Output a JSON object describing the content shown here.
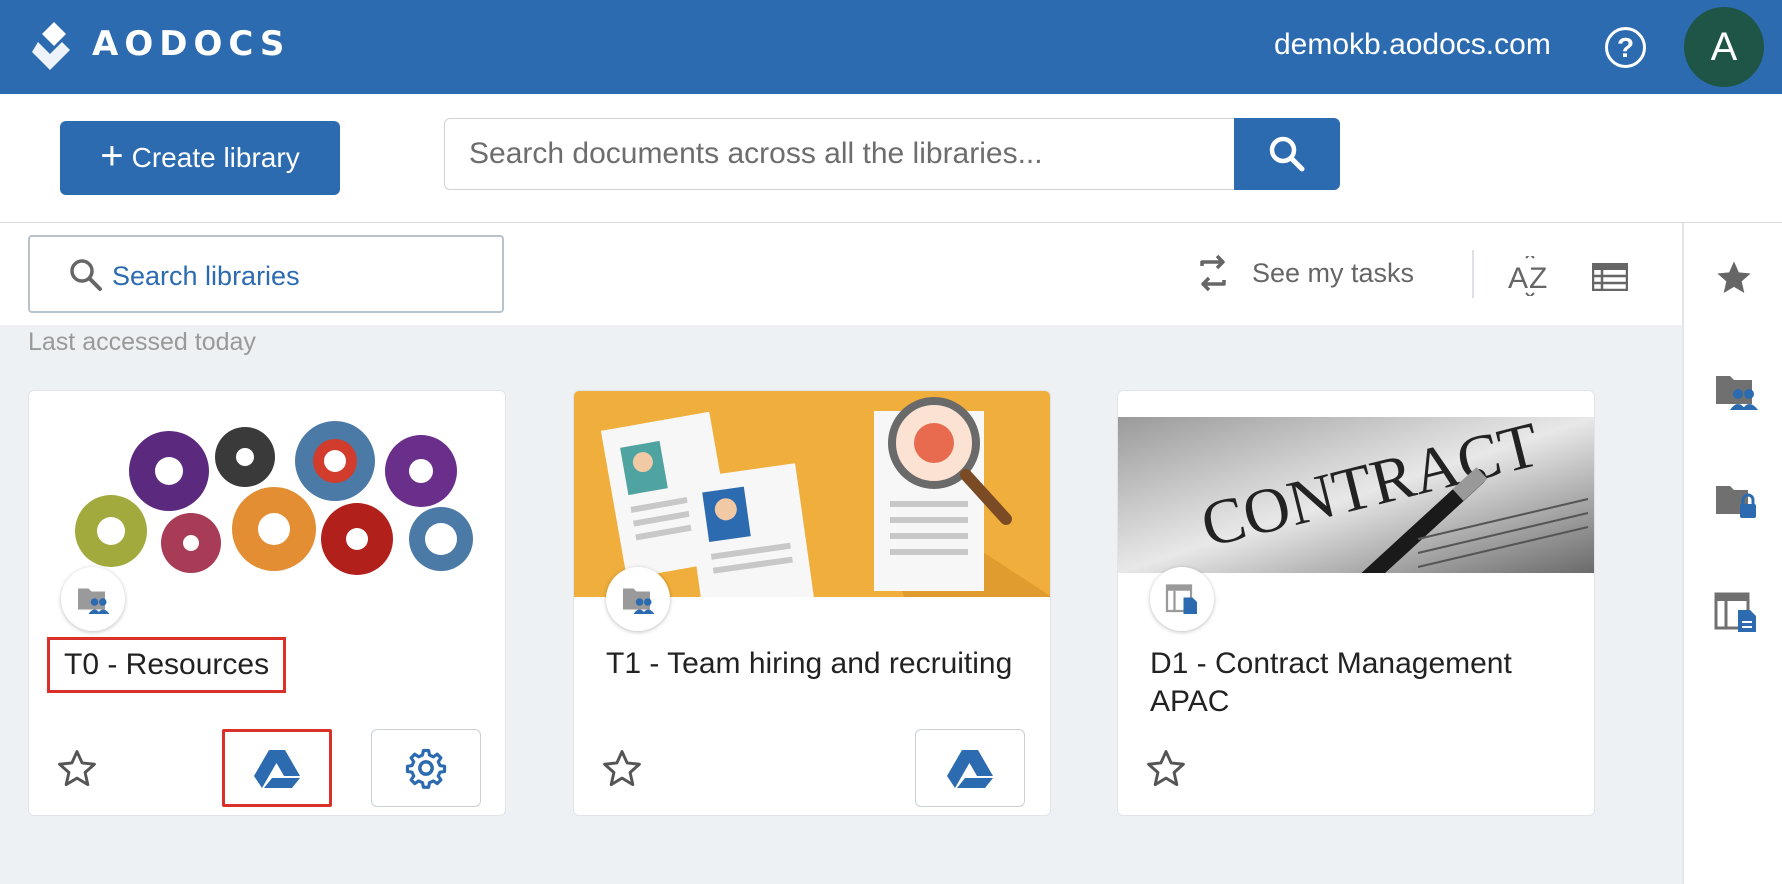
{
  "header": {
    "brand": "AODOCS",
    "domain": "demokb.aodocs.com",
    "help_label": "?",
    "avatar_letter": "A"
  },
  "toolbar": {
    "create_plus": "+",
    "create_label": "Create library",
    "search_placeholder": "Search documents across all the libraries..."
  },
  "filters": {
    "search_libraries_label": "Search libraries",
    "see_my_tasks_label": "See my tasks",
    "section_label": "Last accessed today"
  },
  "icons": {
    "rail": [
      "star-icon",
      "team-folder-icon",
      "secured-folder-icon",
      "document-management-icon"
    ]
  },
  "cards": [
    {
      "title": "T0 - Resources",
      "type_icon": "team-folder-icon",
      "actions": [
        "google-drive-icon",
        "gear-icon"
      ]
    },
    {
      "title": "T1 - Team hiring and recruiting",
      "type_icon": "team-folder-icon",
      "actions": [
        "google-drive-icon"
      ]
    },
    {
      "title": "D1 - Contract Management APAC",
      "type_icon": "document-management-icon",
      "actions": []
    }
  ],
  "banner_texts": {
    "contract_word": "CONTRACT"
  },
  "colors": {
    "primary": "#2c6bb0",
    "avatar": "#1e5547",
    "highlight": "#d9302a",
    "background": "#eef1f4"
  }
}
